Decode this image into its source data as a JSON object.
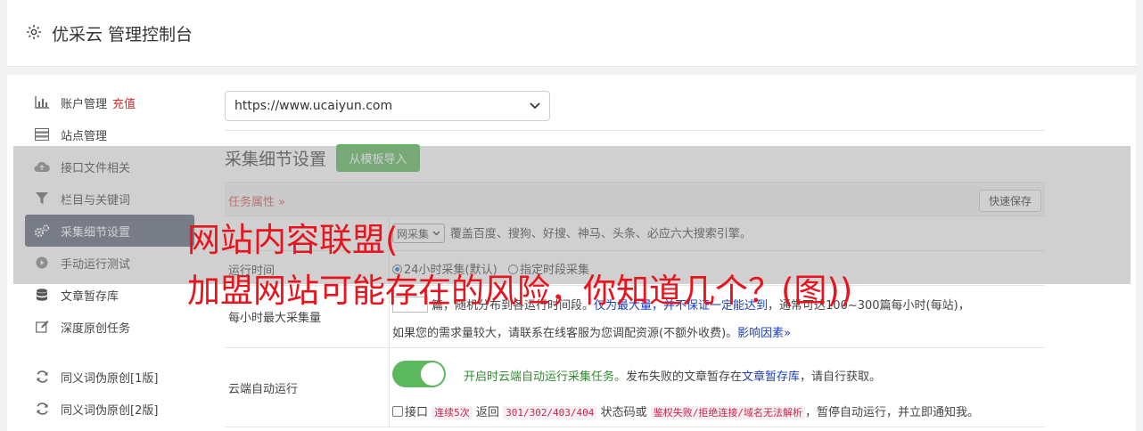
{
  "header": {
    "title": "优采云 管理控制台"
  },
  "sidebar": {
    "items": [
      {
        "label": "账户管理",
        "extra": "充值",
        "icon": "bar-chart-icon"
      },
      {
        "label": "站点管理",
        "icon": "server-icon"
      },
      {
        "label": "接口文件相关",
        "icon": "cloud-upload-icon"
      },
      {
        "label": "栏目与关键词",
        "icon": "filter-icon"
      },
      {
        "label": "采集细节设置",
        "icon": "gears-icon",
        "active": true
      },
      {
        "label": "手动运行测试",
        "icon": "play-circle-icon"
      },
      {
        "label": "文章暂存库",
        "icon": "database-icon"
      },
      {
        "label": "深度原创任务",
        "icon": "edit-icon"
      },
      {
        "label": "同义词伪原创[1版]",
        "icon": "refresh-icon"
      },
      {
        "label": "同义词伪原创[2版]",
        "icon": "refresh-icon"
      }
    ]
  },
  "site_select": {
    "value": "https://www.ucaiyun.com"
  },
  "section": {
    "title": "采集细节设置",
    "template_button": "从模板导入"
  },
  "task_bar": {
    "label": "任务属性",
    "quick_save": "快速保存"
  },
  "row1": {
    "select_value": "网采集",
    "text": "覆盖百度、搜狗、好搜、神马、头条、必应六大搜索引擎。"
  },
  "row2": {
    "label": "运行时间",
    "opt1": "24小时采集(默认)",
    "opt2": "指定时段采集"
  },
  "row3": {
    "label": "每小时最大采集量",
    "line1_a": "篇，随机分布到各运行时间段。",
    "line1_b": "仅为最大量，并不保证一定能达到",
    "line1_c": "，通常可达100~300篇每小时(每站)，",
    "line2": "如果您的需求量较大，请联系在线客服为您调配资源(不额外收费)。",
    "line2_link": "影响因素"
  },
  "row4": {
    "label": "云端自动运行",
    "on_text": "开启时云端自动运行采集任务。",
    "desc_a": "发布失败的文章暂存在",
    "desc_link": "文章暂存库",
    "desc_b": "，请自行获取。",
    "c_prefix": "接口",
    "c_code1": "连续5次",
    "c_mid1": "返回",
    "c_code2": "301/302/403/404",
    "c_mid2": "状态码或",
    "c_code3": "鉴权失败/拒绝连接/域名无法解析",
    "c_suffix": "，暂停自动运行，并立即通知我。"
  },
  "headline": {
    "line1": "网站内容联盟(",
    "line2": "加盟网站可能存在的风险，你知道几个？(图))"
  },
  "colors": {
    "active_nav": "#5d6778",
    "accent_green": "#5cb85c",
    "headline_red": "#e8131c"
  }
}
